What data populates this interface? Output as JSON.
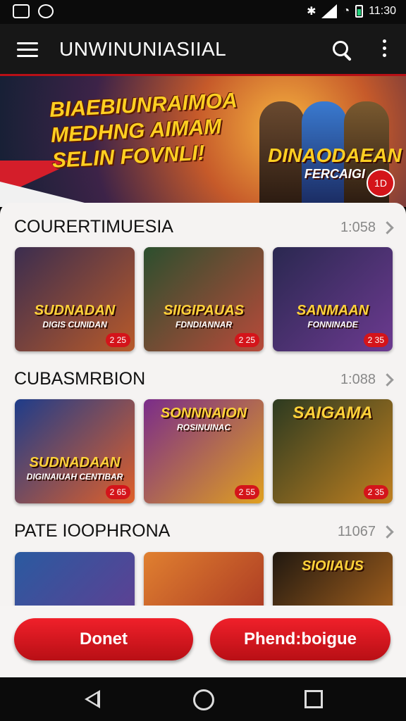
{
  "status_bar": {
    "left_icons": [
      "gallery-icon",
      "shield-icon"
    ],
    "right_icons": [
      "bluetooth-icon",
      "signal-icon",
      "wifi-icon",
      "battery-icon"
    ],
    "time": "11:30"
  },
  "app_bar": {
    "title": "UNWINUNIASIIAL",
    "icons": [
      "menu-icon",
      "search-icon",
      "more-vert-icon"
    ]
  },
  "banner": {
    "headline_lines": [
      "BIAEBIUNRAIMOA",
      "MEDHNG AIMAM",
      "SELIN FOVNLI!"
    ],
    "game_title": "DINAODAEAN",
    "game_subtitle": "FERCAIGI",
    "badge": "1D"
  },
  "sections": [
    {
      "title": "COURERTIMUESIA",
      "meta": "1:058",
      "cards": [
        {
          "title": "SUDNADAN",
          "subtitle": "DIGIS CUNIDAN",
          "tag": "2 25",
          "colors": [
            "#3b2d4f",
            "#b85a2a"
          ]
        },
        {
          "title": "SIIGIPAUAS",
          "subtitle": "FDNDIANNAR",
          "tag": "2 25",
          "colors": [
            "#2c4f2e",
            "#b84a3a"
          ]
        },
        {
          "title": "SANMAAN",
          "subtitle": "FONNINADE",
          "tag": "2 35",
          "colors": [
            "#2a2850",
            "#6c3a90"
          ]
        }
      ]
    },
    {
      "title": "CUBASMRBION",
      "meta": "1:088",
      "cards": [
        {
          "title": "SUDNADAAN",
          "subtitle": "DIGINAIUAH CENTIBAR",
          "tag": "2 65",
          "colors": [
            "#1e3c8a",
            "#e0602a"
          ]
        },
        {
          "title": "SONNNAION",
          "subtitle": "ROSINUINAC",
          "tag": "2 55",
          "colors": [
            "#7a2c8a",
            "#e0a020"
          ]
        },
        {
          "title": "SAIGAMA",
          "subtitle": "",
          "tag": "2 35",
          "colors": [
            "#2c3a20",
            "#c08020"
          ]
        }
      ]
    },
    {
      "title": "PATE IOOPHRONA",
      "meta": "11067",
      "cards": [
        {
          "title": "",
          "subtitle": "",
          "tag": "",
          "colors": [
            "#2a5aa0",
            "#6a3a90"
          ]
        },
        {
          "title": "",
          "subtitle": "",
          "tag": "",
          "colors": [
            "#e08030",
            "#a02a20"
          ]
        },
        {
          "title": "SIOIIAUS",
          "subtitle": "",
          "tag": "",
          "colors": [
            "#201810",
            "#c07020"
          ]
        }
      ]
    }
  ],
  "buttons": {
    "left_label": "Donet",
    "right_label": "Phend:boigue"
  },
  "nav_bar": {
    "icons": [
      "back-icon",
      "home-icon",
      "recents-icon"
    ]
  }
}
